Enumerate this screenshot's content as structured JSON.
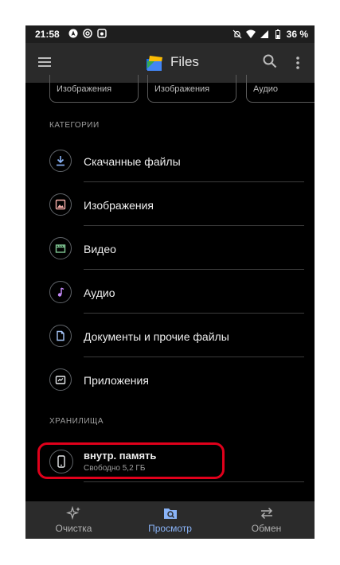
{
  "status_bar": {
    "time": "21:58",
    "battery": "36 %"
  },
  "app_bar": {
    "title": "Files"
  },
  "chips": [
    "Изображения",
    "Изображения",
    "Аудио"
  ],
  "categories": {
    "section_label": "КАТЕГОРИИ",
    "items": [
      {
        "label": "Скачанные файлы",
        "icon": "download-icon"
      },
      {
        "label": "Изображения",
        "icon": "image-icon"
      },
      {
        "label": "Видео",
        "icon": "video-icon"
      },
      {
        "label": "Аудио",
        "icon": "music-icon"
      },
      {
        "label": "Документы и прочие файлы",
        "icon": "document-icon"
      },
      {
        "label": "Приложения",
        "icon": "apps-icon"
      }
    ]
  },
  "storage": {
    "section_label": "ХРАНИЛИЩА",
    "name": "внутр. память",
    "free": "Свободно 5,2 ГБ"
  },
  "bottom_nav": {
    "items": [
      {
        "label": "Очистка",
        "icon": "sparkle-icon",
        "active": false
      },
      {
        "label": "Просмотр",
        "icon": "browse-icon",
        "active": true
      },
      {
        "label": "Обмен",
        "icon": "swap-icon",
        "active": false
      }
    ]
  },
  "colors": {
    "accent": "#8ab4f8",
    "highlight": "#e0001b",
    "background": "#000000"
  }
}
